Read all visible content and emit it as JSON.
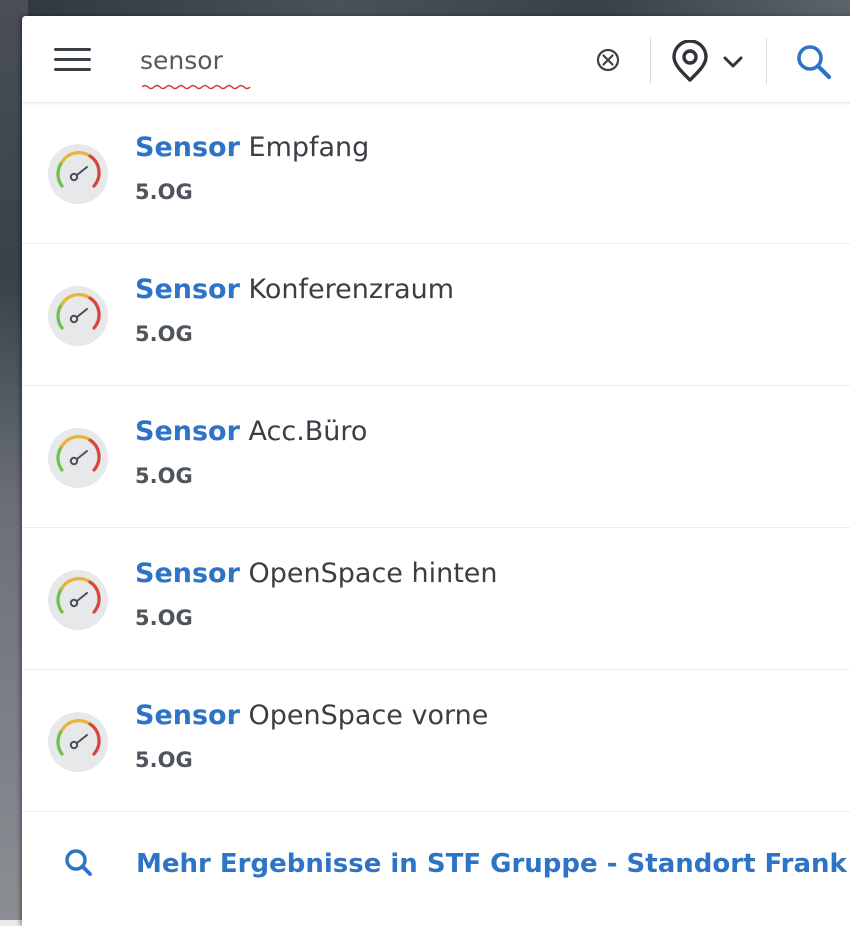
{
  "search": {
    "value": "sensor",
    "placeholder": ""
  },
  "icons": {
    "menu": "hamburger-menu-icon",
    "clear": "clear-circle-x-icon",
    "location": "location-pin-icon",
    "dropdown": "chevron-down-icon",
    "search": "magnifier-icon",
    "result": "gauge-sensor-icon"
  },
  "colors": {
    "accent": "#2d74c6",
    "text": "#3a3f45",
    "gauge_green": "#6fbf4a",
    "gauge_yellow": "#e7b43a",
    "gauge_red": "#d9453b"
  },
  "results": [
    {
      "highlight": "Sensor",
      "rest": " Empfang",
      "floor": "5.OG"
    },
    {
      "highlight": "Sensor",
      "rest": " Konferenzraum",
      "floor": "5.OG"
    },
    {
      "highlight": "Sensor",
      "rest": " Acc.Büro",
      "floor": "5.OG"
    },
    {
      "highlight": "Sensor",
      "rest": " OpenSpace hinten",
      "floor": "5.OG"
    },
    {
      "highlight": "Sensor",
      "rest": " OpenSpace vorne",
      "floor": "5.OG"
    }
  ],
  "more_results": {
    "label": "Mehr Ergebnisse in STF Gruppe - Standort Frank"
  }
}
